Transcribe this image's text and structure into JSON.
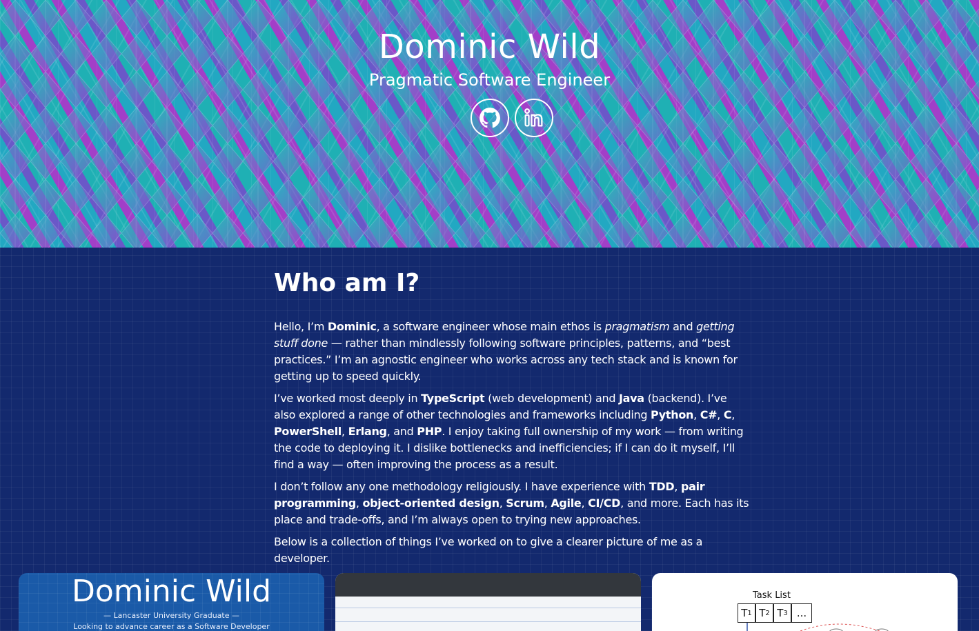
{
  "hero": {
    "name": "Dominic Wild",
    "tagline": "Pragmatic Software Engineer",
    "links": [
      {
        "label": "GitHub",
        "icon": "github-icon"
      },
      {
        "label": "LinkedIn",
        "icon": "linkedin-icon"
      }
    ]
  },
  "about": {
    "heading": "Who am I?",
    "p1": {
      "a": "Hello, I’m ",
      "b": "Dominic",
      "c": ", a software engineer whose main ethos is ",
      "d": "pragmatism",
      "e": " and ",
      "f": "getting stuff done",
      "g": " — rather than mindlessly following software principles, patterns, and “best practices.” I’m an agnostic engineer who works across any tech stack and is known for getting up to speed quickly."
    },
    "p2": {
      "a": "I’ve worked most deeply in ",
      "b": "TypeScript",
      "c": " (web development) and ",
      "d": "Java",
      "e": " (backend). I’ve also explored a range of other technologies and frameworks including ",
      "f": "Python",
      "g": ", ",
      "h": "C#",
      "i": ", ",
      "j": "C",
      "k": ", ",
      "l": "PowerShell",
      "m": ", ",
      "n": "Erlang",
      "o": ", and ",
      "p": "PHP",
      "q": ". I enjoy taking full ownership of my work — from writing the code to deploying it. I dislike bottlenecks and inefficiencies; if I can do it myself, I’ll find a way — often improving the process as a result."
    },
    "p3": {
      "a": "I don’t follow any one methodology religiously. I have experience with ",
      "b": "TDD",
      "c": ", ",
      "d": "pair programming",
      "e": ", ",
      "f": "object-oriented design",
      "g": ", ",
      "h": "Scrum",
      "i": ", ",
      "j": "Agile",
      "k": ", ",
      "l": "CI/CD",
      "m": ", and more. Each has its place and trade-offs, and I’m always open to trying new approaches."
    },
    "p4": "Below is a collection of things I’ve worked on to give a clearer picture of me as a developer."
  },
  "projects": {
    "card1": {
      "title": "Dominic Wild",
      "line1": "— Lancaster University Graduate —",
      "line2": "Looking to advance career as a Software Developer"
    },
    "card3": {
      "task_label": "Task List",
      "cells": [
        "T",
        "T",
        "T",
        "..."
      ],
      "subs": [
        "1",
        "2",
        "3"
      ]
    }
  },
  "colors": {
    "page_bg": "#13296e",
    "hero_teal": "#22a8c2",
    "hero_purple": "#a23fc8",
    "text": "#ffffff"
  }
}
